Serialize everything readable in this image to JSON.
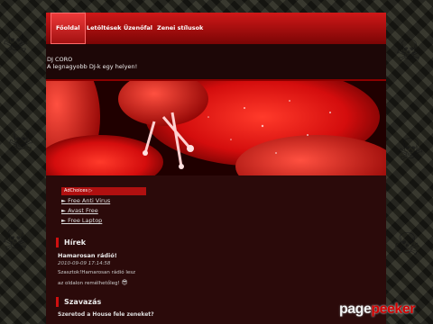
{
  "nav": [
    {
      "label": "Főoldal",
      "active": true
    },
    {
      "label": "Letöltések",
      "active": false
    },
    {
      "label": "Üzenőfal",
      "active": false
    },
    {
      "label": "Zenei stílusok",
      "active": false
    }
  ],
  "site": {
    "title": "DJ CORO",
    "subtitle": "A legnagyobb DJ-k egy helyen!"
  },
  "ads": {
    "label": "AdChoices ▷",
    "links": [
      "► Free Anti Virus",
      "► Avast Free",
      "► Free Laptop"
    ]
  },
  "news": {
    "heading": "Hírek",
    "title": "Hamarosan rádió!",
    "date": "2010-09-09 17:14:58",
    "text_line1": "Szasztok!Hamarosan rádió lesz",
    "text_line2": "az oldalon remélhetőleg!",
    "emoji": "😎"
  },
  "poll": {
    "heading": "Szavazás",
    "question": "Szeretod a House fele zeneket?"
  },
  "watermark": {
    "part1": "page",
    "part2": "peeker"
  },
  "colors": {
    "accent": "#d01010",
    "page_bg": "#1d0707"
  }
}
